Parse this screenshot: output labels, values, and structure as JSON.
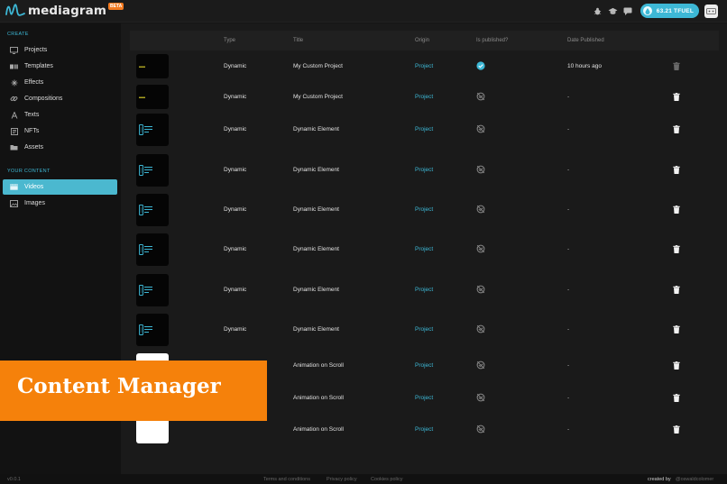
{
  "app": {
    "name": "mediagram",
    "badge": "BETA"
  },
  "header": {
    "tfuel_balance": "63.21 TFUEL"
  },
  "sidebar": {
    "create_label": "CREATE",
    "create_items": [
      {
        "label": "Projects",
        "icon": "monitor-icon"
      },
      {
        "label": "Templates",
        "icon": "templates-icon"
      },
      {
        "label": "Effects",
        "icon": "sparkle-icon"
      },
      {
        "label": "Compositions",
        "icon": "link-icon"
      },
      {
        "label": "Texts",
        "icon": "text-icon"
      },
      {
        "label": "NFTs",
        "icon": "nft-icon"
      },
      {
        "label": "Assets",
        "icon": "folder-icon"
      }
    ],
    "content_label": "YOUR CONTENT",
    "content_items": [
      {
        "label": "Videos",
        "icon": "video-icon",
        "active": true
      },
      {
        "label": "Images",
        "icon": "image-icon",
        "active": false
      }
    ]
  },
  "table": {
    "columns": [
      "Type",
      "Title",
      "Origin",
      "Is published?",
      "Date Published"
    ],
    "rows": [
      {
        "type": "Dynamic",
        "title": "My Custom Project",
        "origin": "Project",
        "published": true,
        "date": "10 hours ago",
        "thumb": "dark"
      },
      {
        "type": "Dynamic",
        "title": "My Custom Project",
        "origin": "Project",
        "published": false,
        "date": "-",
        "thumb": "dark"
      },
      {
        "type": "Dynamic",
        "title": "Dynamic Element",
        "origin": "Project",
        "published": false,
        "date": "-",
        "thumb": "logo"
      },
      {
        "type": "Dynamic",
        "title": "Dynamic Element",
        "origin": "Project",
        "published": false,
        "date": "-",
        "thumb": "logo"
      },
      {
        "type": "Dynamic",
        "title": "Dynamic Element",
        "origin": "Project",
        "published": false,
        "date": "-",
        "thumb": "logo"
      },
      {
        "type": "Dynamic",
        "title": "Dynamic Element",
        "origin": "Project",
        "published": false,
        "date": "-",
        "thumb": "logo"
      },
      {
        "type": "Dynamic",
        "title": "Dynamic Element",
        "origin": "Project",
        "published": false,
        "date": "-",
        "thumb": "logo"
      },
      {
        "type": "Dynamic",
        "title": "Dynamic Element",
        "origin": "Project",
        "published": false,
        "date": "-",
        "thumb": "logo"
      },
      {
        "type": "",
        "title": "Animation on Scroll",
        "origin": "Project",
        "published": false,
        "date": "-",
        "thumb": "white"
      },
      {
        "type": "",
        "title": "Animation on Scroll",
        "origin": "Project",
        "published": false,
        "date": "-",
        "thumb": "white"
      },
      {
        "type": "",
        "title": "Animation on Scroll",
        "origin": "Project",
        "published": false,
        "date": "-",
        "thumb": "white"
      }
    ]
  },
  "footer": {
    "version": "v0.0.1",
    "terms": "Terms and conditions",
    "privacy": "Privacy policy",
    "cookies": "Cookies policy",
    "credit_label": "created by",
    "credit_name": "@oswaldcolomer"
  },
  "banner": {
    "text": "Content Manager"
  },
  "colors": {
    "accent": "#3db8d6",
    "banner": "#f5810b"
  }
}
